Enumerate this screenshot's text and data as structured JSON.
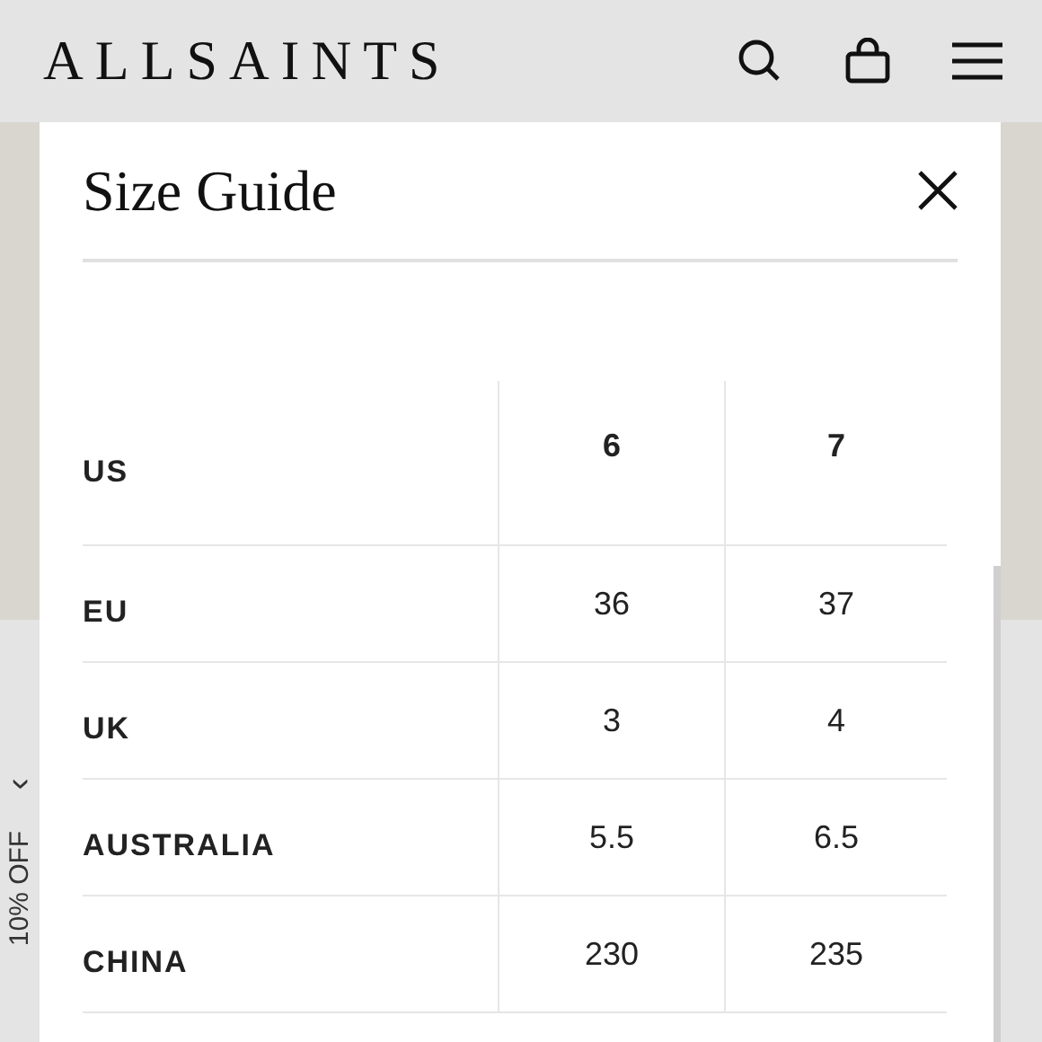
{
  "header": {
    "logo": "ALLSAINTS"
  },
  "promo_tab": {
    "label": "10% OFF",
    "arrow": "›"
  },
  "modal": {
    "title": "Size Guide",
    "table": {
      "columns": [
        "US",
        "6",
        "7"
      ],
      "rows": [
        [
          "EU",
          "36",
          "37"
        ],
        [
          "UK",
          "3",
          "4"
        ],
        [
          "AUSTRALIA",
          "5.5",
          "6.5"
        ],
        [
          "CHINA",
          "230",
          "235"
        ]
      ]
    }
  }
}
